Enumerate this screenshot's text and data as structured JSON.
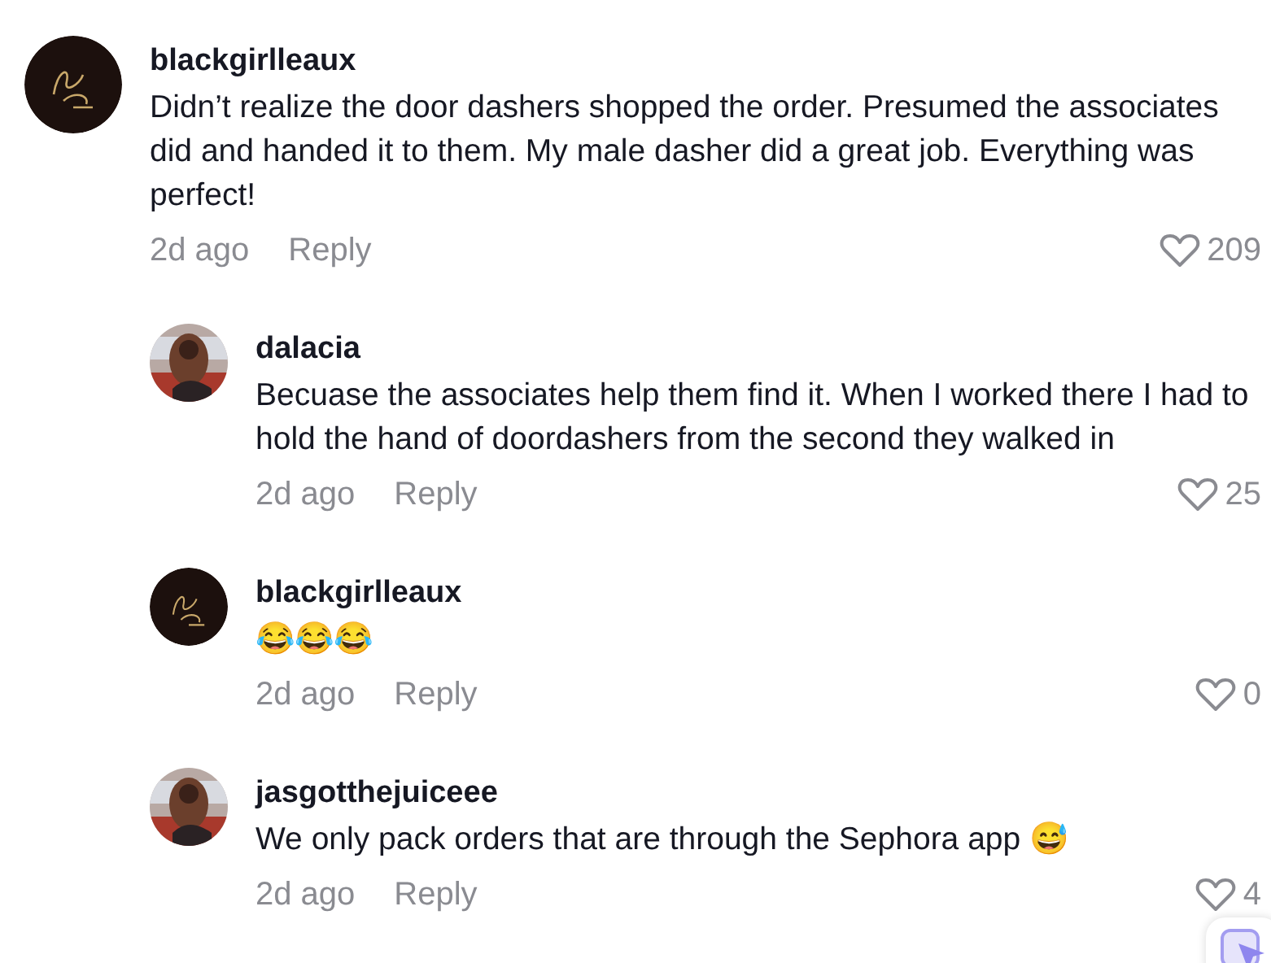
{
  "comments": [
    {
      "kind": "top",
      "avatar": {
        "kind": "logo"
      },
      "username": "blackgirlleaux",
      "text": "Didn’t realize the door dashers shopped the order. Presumed the associates did and handed it to them. My male dasher did a great job. Everything was perfect!",
      "date": "2d ago",
      "reply": "Reply",
      "likes": "209"
    },
    {
      "kind": "reply",
      "username": "dalacia",
      "text": "Becuase the associates help them find it. When I worked there I had to hold the hand of doordashers from the second they walked in",
      "date": "2d ago",
      "reply": "Reply",
      "likes": "25"
    },
    {
      "kind": "reply",
      "avatar": {
        "kind": "logo"
      },
      "username": "blackgirlleaux",
      "text": "😂😂😂",
      "date": "2d ago",
      "reply": "Reply",
      "likes": "0"
    },
    {
      "kind": "reply",
      "username": "jasgotthejuiceee",
      "text": "We only pack orders that are through the Sephora app 😅",
      "date": "2d ago",
      "reply": "Reply",
      "likes": "4"
    }
  ]
}
